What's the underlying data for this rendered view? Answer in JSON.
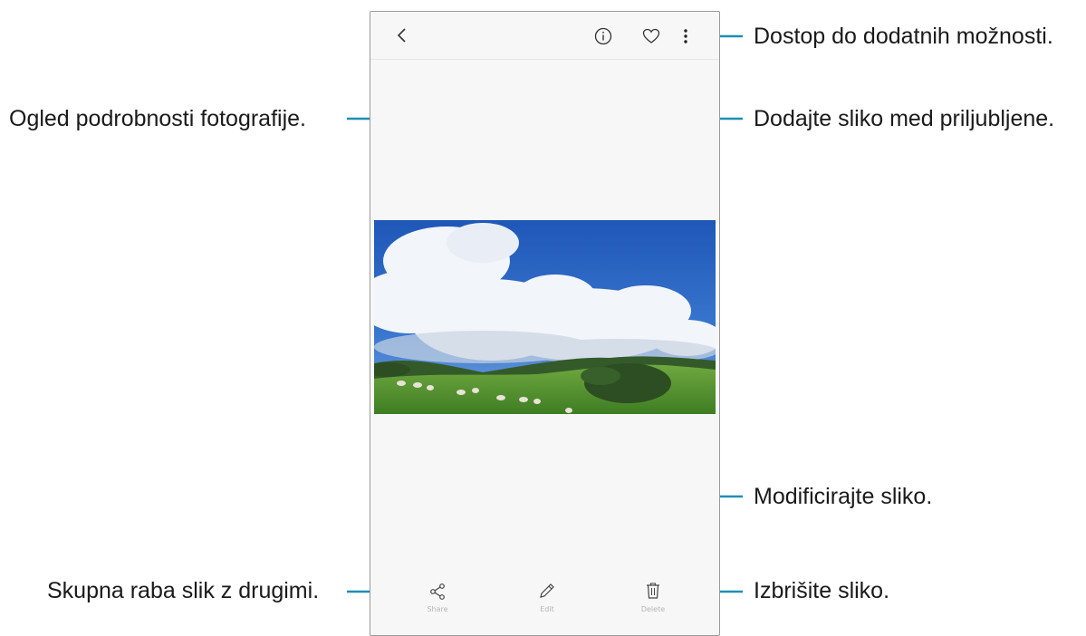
{
  "colors": {
    "callout_line": "#1e8fb3",
    "frame": "#9a9a9a",
    "screen_bg": "#f7f7f7"
  },
  "toolbar": {
    "back_icon": "chevron-left-icon",
    "details_icon": "info-icon",
    "favorite_icon": "heart-icon",
    "more_icon": "more-vertical-icon"
  },
  "bottom_bar": {
    "share_label": "Share",
    "edit_label": "Edit",
    "delete_label": "Delete",
    "share_icon": "share-icon",
    "edit_icon": "pencil-icon",
    "delete_icon": "trash-icon"
  },
  "callouts": {
    "more_options": "Dostop do dodatnih možnosti.",
    "photo_details": "Ogled podrobnosti fotografije.",
    "add_favorite": "Dodajte sliko med priljubljene.",
    "edit": "Modificirajte sliko.",
    "share": "Skupna raba slik z drugimi.",
    "delete": "Izbrišite sliko."
  }
}
